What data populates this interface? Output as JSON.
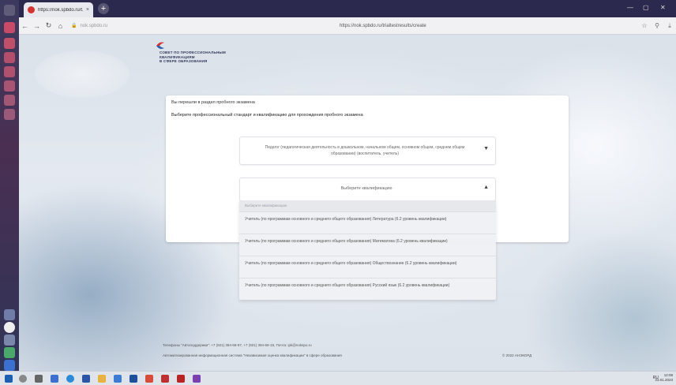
{
  "browser": {
    "tab_title": "https://nok.spbdo.ru/t...",
    "tab_close": "×",
    "new_tab": "+",
    "url_short": "nok.spbdo.ru",
    "url": "https://nok.spbdo.ru/trialtestresults/create",
    "window_controls": {
      "minimize": "—",
      "maximize": "▢",
      "close": "✕"
    }
  },
  "logo": {
    "line1": "СОВЕТ ПО ПРОФЕССИОНАЛЬНЫМ",
    "line2": "КВАЛИФИКАЦИЯМ",
    "line3": "В СФЕРЕ ОБРАЗОВАНИЯ"
  },
  "card": {
    "notice": "Вы перешли в раздел пробного экзамена",
    "instruction": "Выберите профессиональный стандарт и квалификацию для прохождения пробного экзамена"
  },
  "standard_select": {
    "value": "Педагог (педагогическая деятельность в дошкольном, начальном общем, основном общем, среднем общем образовании) (воспитатель, учитель)"
  },
  "qualification_select": {
    "placeholder": "Выберите квалификацию"
  },
  "dropdown": {
    "header": "Выберите квалификацию",
    "options": [
      "Учитель (по программам основного и среднего общего образования) Литература (6.2 уровень квалификации)",
      "Учитель (по программам основного и среднего общего образования) Математика (6.2 уровень квалификации)",
      "Учитель (по программам основного и среднего общего образования) Обществознание (6.2 уровень квалификации)",
      "Учитель (по программам основного и среднего общего образования) Русский язык (6.2 уровень квалификации)"
    ]
  },
  "footer": {
    "contacts": "Телефоны \"Автоподдержки\": +7 (921) 394-68-97, +7 (921) 394-69-18, Почта: ipk@nokspo.ru",
    "system": "Автоматизированная информационная система \"Независимая оценка квалификации\" в сфере образования",
    "copyright": "© 2022 АНЭКОРД"
  },
  "taskbar": {
    "tray": "RU",
    "time": "12:08",
    "date": "23.01.2023"
  },
  "colors": {
    "sidebar": "#3b3a5e",
    "tabbar": "#2b2a4e",
    "logo_red": "#d6322f",
    "logo_blue": "#2c5fb0"
  }
}
